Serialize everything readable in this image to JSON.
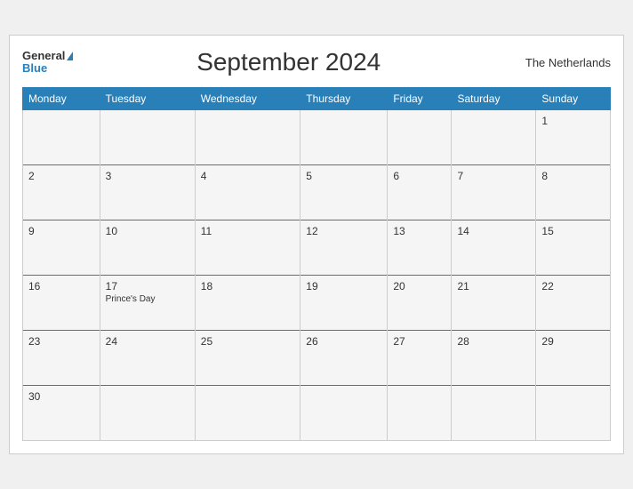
{
  "header": {
    "logo_general": "General",
    "logo_blue": "Blue",
    "title": "September 2024",
    "country": "The Netherlands"
  },
  "days_of_week": [
    "Monday",
    "Tuesday",
    "Wednesday",
    "Thursday",
    "Friday",
    "Saturday",
    "Sunday"
  ],
  "weeks": [
    [
      {
        "date": "",
        "event": ""
      },
      {
        "date": "",
        "event": ""
      },
      {
        "date": "",
        "event": ""
      },
      {
        "date": "",
        "event": ""
      },
      {
        "date": "",
        "event": ""
      },
      {
        "date": "",
        "event": ""
      },
      {
        "date": "1",
        "event": ""
      }
    ],
    [
      {
        "date": "2",
        "event": ""
      },
      {
        "date": "3",
        "event": ""
      },
      {
        "date": "4",
        "event": ""
      },
      {
        "date": "5",
        "event": ""
      },
      {
        "date": "6",
        "event": ""
      },
      {
        "date": "7",
        "event": ""
      },
      {
        "date": "8",
        "event": ""
      }
    ],
    [
      {
        "date": "9",
        "event": ""
      },
      {
        "date": "10",
        "event": ""
      },
      {
        "date": "11",
        "event": ""
      },
      {
        "date": "12",
        "event": ""
      },
      {
        "date": "13",
        "event": ""
      },
      {
        "date": "14",
        "event": ""
      },
      {
        "date": "15",
        "event": ""
      }
    ],
    [
      {
        "date": "16",
        "event": ""
      },
      {
        "date": "17",
        "event": "Prince's Day"
      },
      {
        "date": "18",
        "event": ""
      },
      {
        "date": "19",
        "event": ""
      },
      {
        "date": "20",
        "event": ""
      },
      {
        "date": "21",
        "event": ""
      },
      {
        "date": "22",
        "event": ""
      }
    ],
    [
      {
        "date": "23",
        "event": ""
      },
      {
        "date": "24",
        "event": ""
      },
      {
        "date": "25",
        "event": ""
      },
      {
        "date": "26",
        "event": ""
      },
      {
        "date": "27",
        "event": ""
      },
      {
        "date": "28",
        "event": ""
      },
      {
        "date": "29",
        "event": ""
      }
    ],
    [
      {
        "date": "30",
        "event": ""
      },
      {
        "date": "",
        "event": ""
      },
      {
        "date": "",
        "event": ""
      },
      {
        "date": "",
        "event": ""
      },
      {
        "date": "",
        "event": ""
      },
      {
        "date": "",
        "event": ""
      },
      {
        "date": "",
        "event": ""
      }
    ]
  ]
}
